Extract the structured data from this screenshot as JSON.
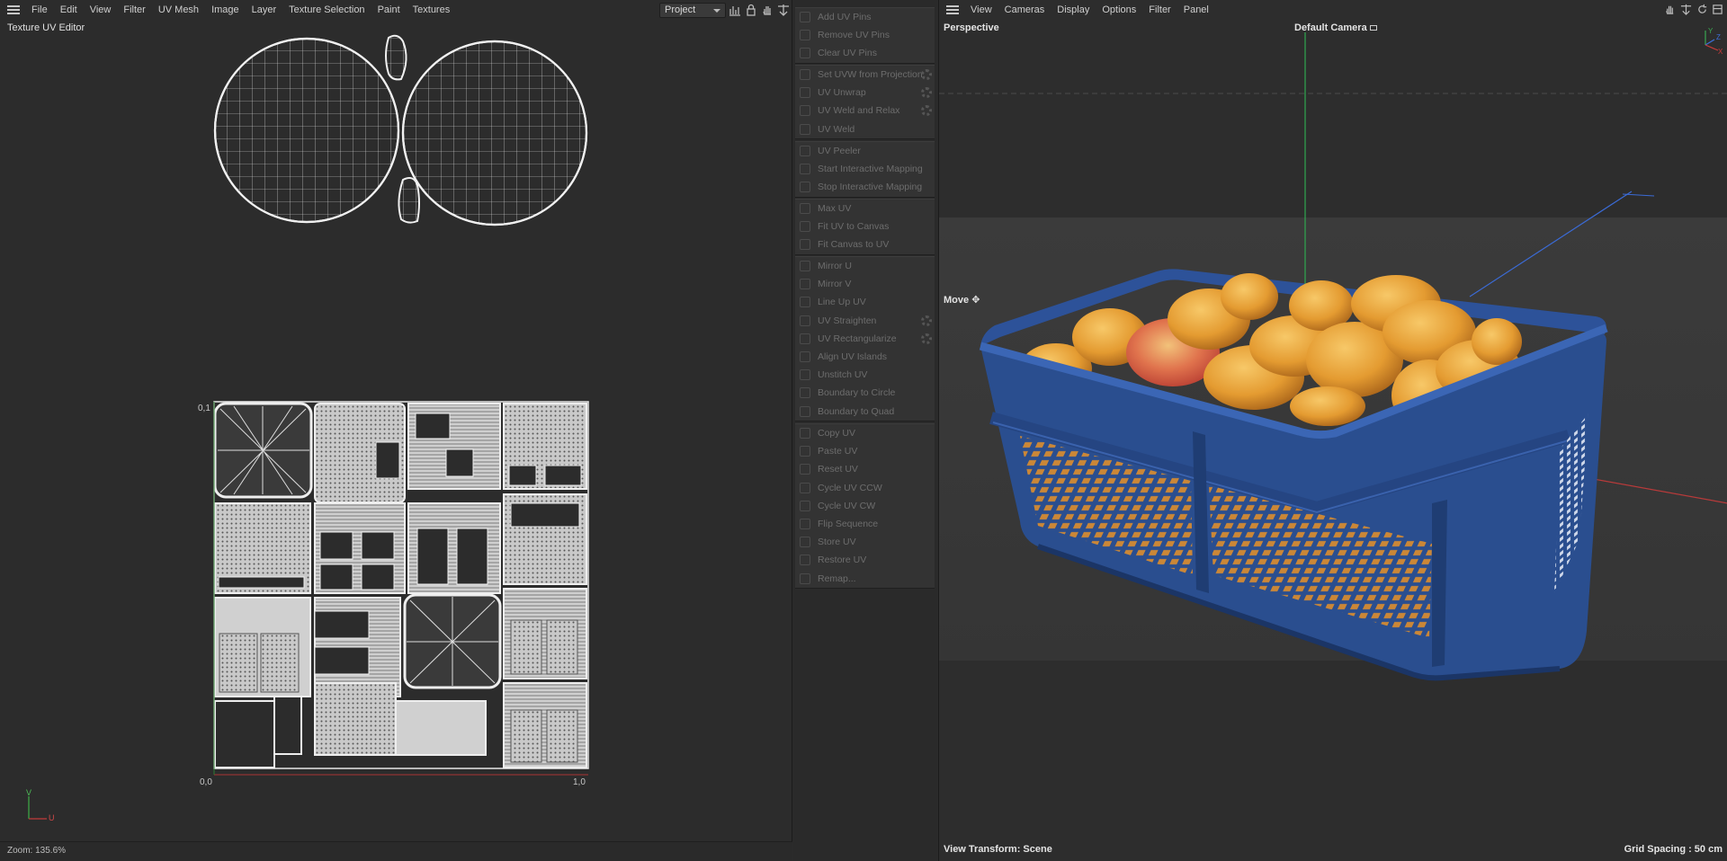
{
  "uv_editor": {
    "menu": [
      "File",
      "Edit",
      "View",
      "Filter",
      "UV Mesh",
      "Image",
      "Layer",
      "Texture Selection",
      "Paint",
      "Textures"
    ],
    "title": "Texture UV Editor",
    "project_select": "Project",
    "labels": {
      "origin": "0,0",
      "top_left": "0,1",
      "bottom_right": "1,0",
      "axis_v": "V",
      "axis_u": "U"
    },
    "zoom": "Zoom: 135.6%"
  },
  "commands": {
    "groups": [
      {
        "items": [
          {
            "label": "Add UV Pins",
            "gear": false
          },
          {
            "label": "Remove UV Pins",
            "gear": false
          },
          {
            "label": "Clear UV Pins",
            "gear": false
          }
        ]
      },
      {
        "items": [
          {
            "label": "Set UVW from Projection",
            "gear": true
          },
          {
            "label": "UV Unwrap",
            "gear": true
          },
          {
            "label": "UV Weld and Relax",
            "gear": true
          },
          {
            "label": "UV Weld",
            "gear": false
          }
        ]
      },
      {
        "items": [
          {
            "label": "UV Peeler",
            "gear": false
          },
          {
            "label": "Start Interactive Mapping",
            "gear": false
          },
          {
            "label": "Stop Interactive Mapping",
            "gear": false
          }
        ]
      },
      {
        "items": [
          {
            "label": "Max UV",
            "gear": false
          },
          {
            "label": "Fit UV to Canvas",
            "gear": false
          },
          {
            "label": "Fit Canvas to UV",
            "gear": false
          }
        ]
      },
      {
        "items": [
          {
            "label": "Mirror U",
            "gear": false
          },
          {
            "label": "Mirror V",
            "gear": false
          },
          {
            "label": "Line Up UV",
            "gear": false
          },
          {
            "label": "UV Straighten",
            "gear": true
          },
          {
            "label": "UV Rectangularize",
            "gear": true
          },
          {
            "label": "Align UV Islands",
            "gear": false
          },
          {
            "label": "Unstitch UV",
            "gear": false
          },
          {
            "label": "Boundary to Circle",
            "gear": false
          },
          {
            "label": "Boundary to Quad",
            "gear": false
          }
        ]
      },
      {
        "items": [
          {
            "label": "Copy UV",
            "gear": false
          },
          {
            "label": "Paste UV",
            "gear": false
          },
          {
            "label": "Reset UV",
            "gear": false
          },
          {
            "label": "Cycle UV CCW",
            "gear": false
          },
          {
            "label": "Cycle UV CW",
            "gear": false
          },
          {
            "label": "Flip Sequence",
            "gear": false
          },
          {
            "label": "Store UV",
            "gear": false
          },
          {
            "label": "Restore UV",
            "gear": false
          },
          {
            "label": "Remap...",
            "gear": false
          }
        ]
      }
    ]
  },
  "viewport": {
    "menu": [
      "View",
      "Cameras",
      "Display",
      "Options",
      "Filter",
      "Panel"
    ],
    "perspective": "Perspective",
    "camera": "Default Camera",
    "move": "Move",
    "view_transform": "View Transform: Scene",
    "grid_spacing": "Grid Spacing : 50 cm",
    "axis_labels": {
      "y": "Y",
      "z": "Z",
      "x": "X"
    }
  },
  "colors": {
    "crate_blue": "#2a4e8f",
    "fruit_orange": "#e9a53a",
    "uv_wire": "#e6e6e6"
  }
}
